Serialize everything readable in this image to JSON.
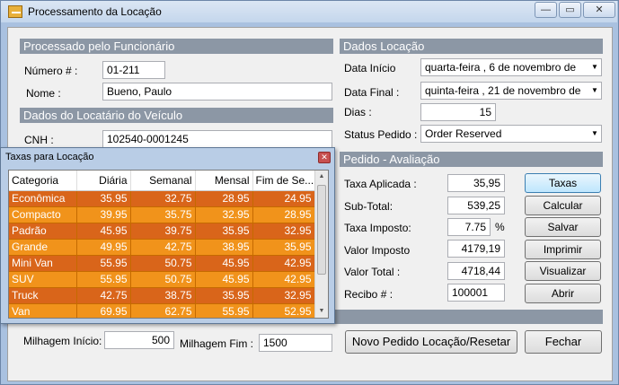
{
  "window": {
    "title": "Processamento da Locação",
    "min": "—",
    "max": "▭",
    "close": "✕"
  },
  "funcionario": {
    "section": "Processado pelo Funcionário",
    "numero_label": "Número # :",
    "numero_value": "01-211",
    "nome_label": "Nome :",
    "nome_value": "Bueno, Paulo"
  },
  "locatario": {
    "section": "Dados do Locatário do Veículo",
    "cnh_label": "CNH :",
    "cnh_value": "102540-0001245"
  },
  "locacao": {
    "section": "Dados Locação",
    "inicio_label": "Data Início",
    "inicio_value": "quarta-feira  ,  6 de novembro de",
    "final_label": "Data Final :",
    "final_value": "quinta-feira  , 21 de novembro de",
    "dias_label": "Dias :",
    "dias_value": "15",
    "status_label": "Status Pedido :",
    "status_value": "Order Reserved"
  },
  "avaliacao": {
    "section": "Pedido - Avaliação",
    "taxa_aplicada_label": "Taxa Aplicada :",
    "taxa_aplicada_value": "35,95",
    "subtotal_label": "Sub-Total:",
    "subtotal_value": "539,25",
    "taxa_imposto_label": "Taxa Imposto:",
    "taxa_imposto_value": "7.75",
    "percent": "%",
    "valor_imposto_label": "Valor Imposto",
    "valor_imposto_value": "4179,19",
    "valor_total_label": "Valor Total :",
    "valor_total_value": "4718,44",
    "recibo_label": "Recibo # :",
    "recibo_value": "100001"
  },
  "buttons": {
    "taxas": "Taxas",
    "calcular": "Calcular",
    "salvar": "Salvar",
    "imprimir": "Imprimir",
    "visualizar": "Visualizar",
    "abrir": "Abrir",
    "novo": "Novo Pedido Locação/Resetar",
    "fechar": "Fechar"
  },
  "milhagem": {
    "inicio_label": "Milhagem Início:",
    "inicio_value": "500",
    "fim_label": "Milhagem Fim :",
    "fim_value": "1500"
  },
  "popup": {
    "title": "Taxas para Locação",
    "headers": [
      "Categoria",
      "Diária",
      "Semanal",
      "Mensal",
      "Fim de Se..."
    ],
    "rows": [
      [
        "Econômica",
        "35.95",
        "32.75",
        "28.95",
        "24.95"
      ],
      [
        "Compacto",
        "39.95",
        "35.75",
        "32.95",
        "28.95"
      ],
      [
        "Padrão",
        "45.95",
        "39.75",
        "35.95",
        "32.95"
      ],
      [
        "Grande",
        "49.95",
        "42.75",
        "38.95",
        "35.95"
      ],
      [
        "Mini Van",
        "55.95",
        "50.75",
        "45.95",
        "42.95"
      ],
      [
        "SUV",
        "55.95",
        "50.75",
        "45.95",
        "42.95"
      ],
      [
        "Truck",
        "42.75",
        "38.75",
        "35.95",
        "32.95"
      ],
      [
        "Van",
        "69.95",
        "62.75",
        "55.95",
        "52.95"
      ]
    ]
  },
  "colors": {
    "row_dark": "#d9651a",
    "row_light": "#f1931b",
    "section_bar": "#8c97a5"
  },
  "icons": {
    "app": "app-icon",
    "close": "close-icon",
    "dropdown": "chevron-down-icon"
  }
}
